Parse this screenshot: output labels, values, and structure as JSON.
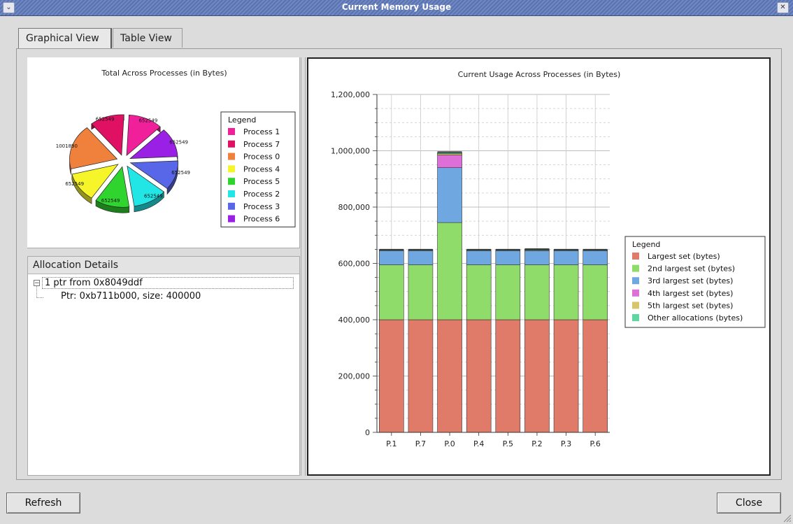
{
  "window": {
    "title": "Current Memory Usage",
    "menu_icon": "window-menu-icon",
    "close_icon": "close-icon"
  },
  "tabs": [
    {
      "label": "Graphical View",
      "active": true
    },
    {
      "label": "Table View",
      "active": false
    }
  ],
  "pie_chart": {
    "title": "Total Across Processes (in Bytes)",
    "legend_title": "Legend",
    "legend": [
      {
        "label": "Process 1",
        "color": "#f0209a"
      },
      {
        "label": "Process 7",
        "color": "#e01063"
      },
      {
        "label": "Process 0",
        "color": "#f0813c"
      },
      {
        "label": "Process 4",
        "color": "#f5f52a"
      },
      {
        "label": "Process 5",
        "color": "#2fd42f"
      },
      {
        "label": "Process 2",
        "color": "#22e5e5"
      },
      {
        "label": "Process 3",
        "color": "#5866e8"
      },
      {
        "label": "Process 6",
        "color": "#9a20e6"
      }
    ]
  },
  "allocation": {
    "header": "Allocation Details",
    "root": "1 ptr from 0x8049ddf",
    "child": "Ptr: 0xb711b000, size: 400000"
  },
  "bar_chart": {
    "title": "Current Usage Across Processes (in Bytes)",
    "legend_title": "Legend"
  },
  "chart_data": [
    {
      "type": "pie",
      "title": "Total Across Processes (in Bytes)",
      "legend_placement": "right",
      "exploded": true,
      "slices": [
        {
          "label": "Process 1",
          "value": 652549,
          "color": "#f0209a"
        },
        {
          "label": "Process 6",
          "value": 652549,
          "color": "#9a20e6"
        },
        {
          "label": "Process 3",
          "value": 652549,
          "color": "#5866e8"
        },
        {
          "label": "Process 2",
          "value": 652549,
          "color": "#22e5e5"
        },
        {
          "label": "Process 5",
          "value": 652549,
          "color": "#2fd42f"
        },
        {
          "label": "Process 4",
          "value": 652549,
          "color": "#f5f52a"
        },
        {
          "label": "Process 0",
          "value": 1001890,
          "color": "#f0813c"
        },
        {
          "label": "Process 7",
          "value": 652549,
          "color": "#e01063"
        }
      ]
    },
    {
      "type": "bar",
      "stacked": true,
      "title": "Current Usage Across Processes (in Bytes)",
      "xlabel": "",
      "ylabel": "",
      "ylim": [
        0,
        1200000
      ],
      "yticks": [
        0,
        200000,
        400000,
        600000,
        800000,
        1000000,
        1200000
      ],
      "ytick_labels": [
        "0",
        "200,000",
        "400,000",
        "600,000",
        "800,000",
        "1,000,000",
        "1,200,000"
      ],
      "grid": true,
      "legend_placement": "right",
      "categories": [
        "P.1",
        "P.7",
        "P.0",
        "P.4",
        "P.5",
        "P.2",
        "P.3",
        "P.6"
      ],
      "series": [
        {
          "name": "Largest set (bytes)",
          "color": "#e07b6a",
          "values": [
            400000,
            400000,
            400000,
            400000,
            400000,
            400000,
            400000,
            400000
          ]
        },
        {
          "name": "2nd largest set (bytes)",
          "color": "#8fdc6a",
          "values": [
            195000,
            195000,
            345000,
            195000,
            195000,
            195000,
            195000,
            195000
          ]
        },
        {
          "name": "3rd largest set (bytes)",
          "color": "#6fa8e0",
          "values": [
            50000,
            50000,
            195000,
            50000,
            50000,
            50000,
            50000,
            50000
          ]
        },
        {
          "name": "4th largest set (bytes)",
          "color": "#de6fd8",
          "values": [
            0,
            0,
            45000,
            0,
            0,
            0,
            0,
            0
          ]
        },
        {
          "name": "5th largest set (bytes)",
          "color": "#d8c46a",
          "values": [
            0,
            0,
            5000,
            0,
            0,
            2000,
            0,
            0
          ]
        },
        {
          "name": "Other allocations (bytes)",
          "color": "#5ed8a0",
          "values": [
            2549,
            2549,
            4000,
            2549,
            2549,
            2549,
            2549,
            2549
          ]
        }
      ]
    }
  ],
  "buttons": {
    "refresh": "Refresh",
    "close": "Close"
  }
}
